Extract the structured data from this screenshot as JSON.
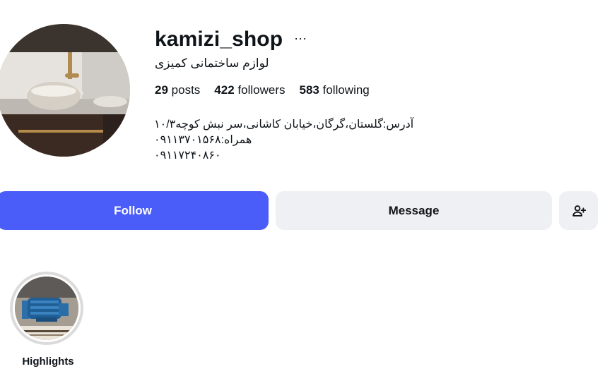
{
  "profile": {
    "username": "kamizi_shop",
    "full_name": "لوازم ساختمانی کمیزی",
    "more_icon": "ellipsis-icon",
    "more_label": "···",
    "avatar_icon": "profile-photo-sink"
  },
  "stats": {
    "posts_count": "29",
    "posts_label": "posts",
    "followers_count": "422",
    "followers_label": "followers",
    "following_count": "583",
    "following_label": "following"
  },
  "bio": {
    "lines": [
      "آدرس:گلستان،گرگان،خیابان کاشانی،سر نبش کوچه۱۰/۳",
      "همراه:۰۹۱۱۳۷۰۱۵۶۸",
      "۰۹۱۱۷۲۴۰۸۶۰"
    ]
  },
  "actions": {
    "follow_label": "Follow",
    "message_label": "Message",
    "suggest_icon": "add-person-icon"
  },
  "highlights": [
    {
      "label": "Highlights",
      "image_icon": "water-pump-photo"
    }
  ],
  "colors": {
    "follow_button": "#4a5df9",
    "secondary_button": "#eff0f4",
    "highlight_ring": "#dbdbdb"
  }
}
